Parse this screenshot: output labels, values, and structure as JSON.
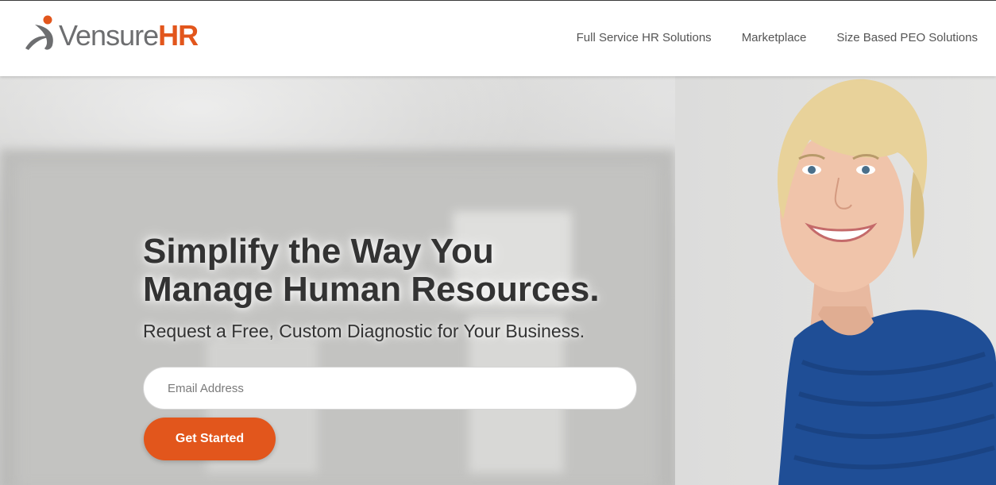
{
  "brand": {
    "name_part1": "Vensure",
    "name_part2": "HR",
    "logo_icon": "vensure-swoosh-icon",
    "accent_color": "#e2561c",
    "gray_color": "#6d6e70"
  },
  "nav": {
    "items": [
      {
        "label": "Full Service HR Solutions"
      },
      {
        "label": "Marketplace"
      },
      {
        "label": "Size Based PEO Solutions"
      }
    ]
  },
  "hero": {
    "headline_line1": "Simplify the Way You",
    "headline_line2": "Manage Human Resources.",
    "subheadline": "Request a Free, Custom Diagnostic for Your Business.",
    "email_placeholder": "Email Address",
    "email_value": "",
    "cta_label": "Get Started",
    "image": "smiling-woman-photo"
  }
}
